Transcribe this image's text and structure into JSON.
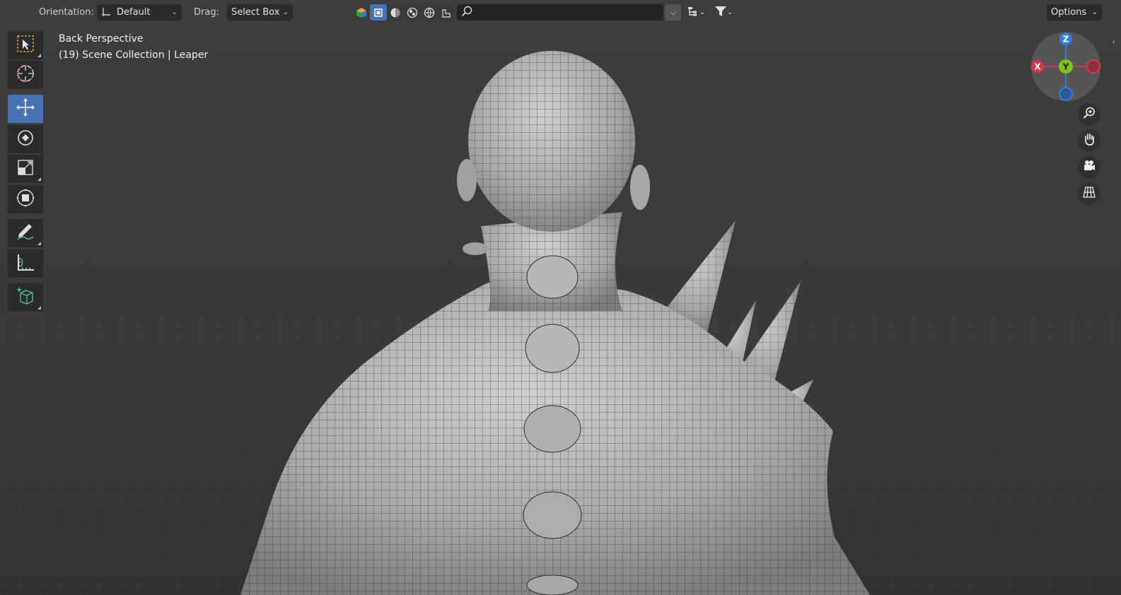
{
  "header": {
    "orientation_label": "Orientation:",
    "orientation_value": "Default",
    "drag_label": "Drag:",
    "drag_value": "Select Box",
    "search_placeholder": "",
    "options_label": "Options"
  },
  "overlay": {
    "view_name": "Back Perspective",
    "collection_info": "(19) Scene Collection | Leaper"
  },
  "gizmo": {
    "z_label": "Z",
    "y_label": "Y",
    "x_label": "X",
    "colors": {
      "x": "#d9344e",
      "y": "#7ec21c",
      "z": "#2f7fd6"
    }
  },
  "toolbar": {
    "tools": [
      "select-box-icon",
      "cursor-icon",
      "move-icon",
      "rotate-icon",
      "scale-icon",
      "transform-icon",
      "annotate-icon",
      "measure-icon",
      "add-cube-icon"
    ],
    "active_tool": "move-icon"
  },
  "nav": [
    "zoom-icon",
    "pan-hand-icon",
    "camera-icon",
    "grid-perspective-icon"
  ],
  "colors": {
    "accent": "#4772b3",
    "background": "#3c3c3c",
    "panel": "#2b2b2b"
  }
}
